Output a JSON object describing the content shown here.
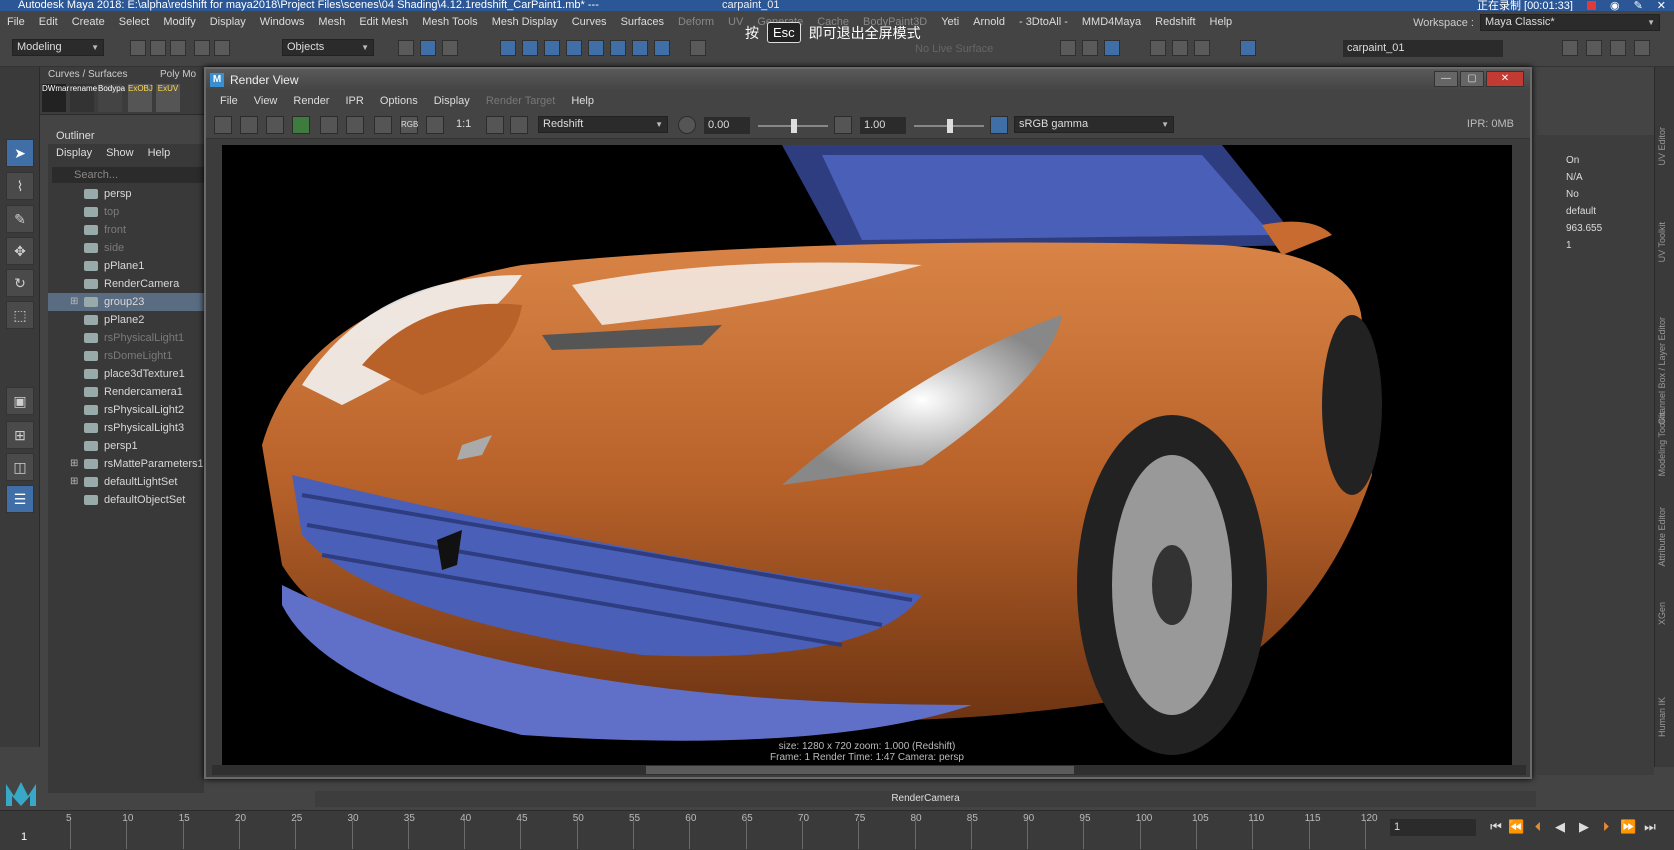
{
  "app": {
    "title": "Autodesk Maya 2018: E:\\alpha\\redshift for maya2018\\Project Files\\scenes\\04 Shading\\4.12.1redshift_CarPaint1.mb*  ---",
    "project_label": "carpaint_01",
    "recording": "正在录制 [00:01:33]",
    "workspace_label": "Workspace :",
    "workspace_value": "Maya Classic*"
  },
  "menus": [
    "File",
    "Edit",
    "Create",
    "Select",
    "Modify",
    "Display",
    "Windows",
    "Mesh",
    "Edit Mesh",
    "Mesh Tools",
    "Mesh Display",
    "Curves",
    "Surfaces",
    "Deform",
    "UV",
    "Generate",
    "Cache",
    "BodyPaint3D",
    "Yeti",
    "Arnold",
    "- 3DtoAll -",
    "MMD4Maya",
    "Redshift",
    "Help"
  ],
  "statusline": {
    "mode": "Modeling",
    "objects": "Objects",
    "no_live": "No Live Surface",
    "field_right": "carpaint_01"
  },
  "esc_banner": {
    "prefix": "按",
    "key": "Esc",
    "suffix": "即可退出全屏模式"
  },
  "shelf": {
    "tabs": [
      "Curves / Surfaces",
      "Poly Mo"
    ],
    "buttons": [
      "DWmar",
      "rename",
      "Bodypa",
      "ExOBJ",
      "ExUV"
    ]
  },
  "outliner": {
    "title": "Outliner",
    "menu": [
      "Display",
      "Show",
      "Help"
    ],
    "search_placeholder": "Search...",
    "items": [
      {
        "label": "persp",
        "dim": false,
        "sel": false,
        "exp": false
      },
      {
        "label": "top",
        "dim": true,
        "sel": false,
        "exp": false
      },
      {
        "label": "front",
        "dim": true,
        "sel": false,
        "exp": false
      },
      {
        "label": "side",
        "dim": true,
        "sel": false,
        "exp": false
      },
      {
        "label": "pPlane1",
        "dim": false,
        "sel": false,
        "exp": false
      },
      {
        "label": "RenderCamera",
        "dim": false,
        "sel": false,
        "exp": false
      },
      {
        "label": "group23",
        "dim": false,
        "sel": true,
        "exp": true
      },
      {
        "label": "pPlane2",
        "dim": false,
        "sel": false,
        "exp": false
      },
      {
        "label": "rsPhysicalLight1",
        "dim": true,
        "sel": false,
        "exp": false
      },
      {
        "label": "rsDomeLight1",
        "dim": true,
        "sel": false,
        "exp": false
      },
      {
        "label": "place3dTexture1",
        "dim": false,
        "sel": false,
        "exp": false
      },
      {
        "label": "Rendercamera1",
        "dim": false,
        "sel": false,
        "exp": false
      },
      {
        "label": "rsPhysicalLight2",
        "dim": false,
        "sel": false,
        "exp": false
      },
      {
        "label": "rsPhysicalLight3",
        "dim": false,
        "sel": false,
        "exp": false
      },
      {
        "label": "persp1",
        "dim": false,
        "sel": false,
        "exp": false
      },
      {
        "label": "rsMatteParameters1",
        "dim": false,
        "sel": false,
        "exp": true
      },
      {
        "label": "defaultLightSet",
        "dim": false,
        "sel": false,
        "exp": true
      },
      {
        "label": "defaultObjectSet",
        "dim": false,
        "sel": false,
        "exp": false
      }
    ]
  },
  "render_view": {
    "title": "Render View",
    "menu": [
      "File",
      "View",
      "Render",
      "IPR",
      "Options",
      "Display",
      "Render Target",
      "Help"
    ],
    "renderer": "Redshift",
    "exposure": "0.00",
    "gamma": "1.00",
    "color_space": "sRGB gamma",
    "ipr_memory": "IPR: 0MB",
    "ratio_label": "1:1",
    "info_line1": "size: 1280 x 720  zoom: 1.000      (Redshift)",
    "info_line2": "Frame: 1      Render Time: 1:47      Camera: persp",
    "car_colors": {
      "paint": "#b8622a",
      "trim": "#4a5fb8",
      "background": "#000000"
    }
  },
  "attribute_values": [
    "On",
    "N/A",
    "No",
    "default",
    "963.655",
    "1"
  ],
  "right_tabs": [
    "UV Editor",
    "UV Toolkit",
    "Channel Box / Layer Editor",
    "Modeling Toolkit",
    "Attribute Editor",
    "XGen",
    "Human IK"
  ],
  "viewport_label": "RenderCamera",
  "timeline": {
    "ticks": [
      "5",
      "10",
      "15",
      "20",
      "25",
      "30",
      "35",
      "40",
      "45",
      "50",
      "55",
      "60",
      "65",
      "70",
      "75",
      "80",
      "85",
      "90",
      "95",
      "100",
      "105",
      "110",
      "115",
      "120"
    ],
    "current_frame": "1",
    "frame_field": "1"
  }
}
